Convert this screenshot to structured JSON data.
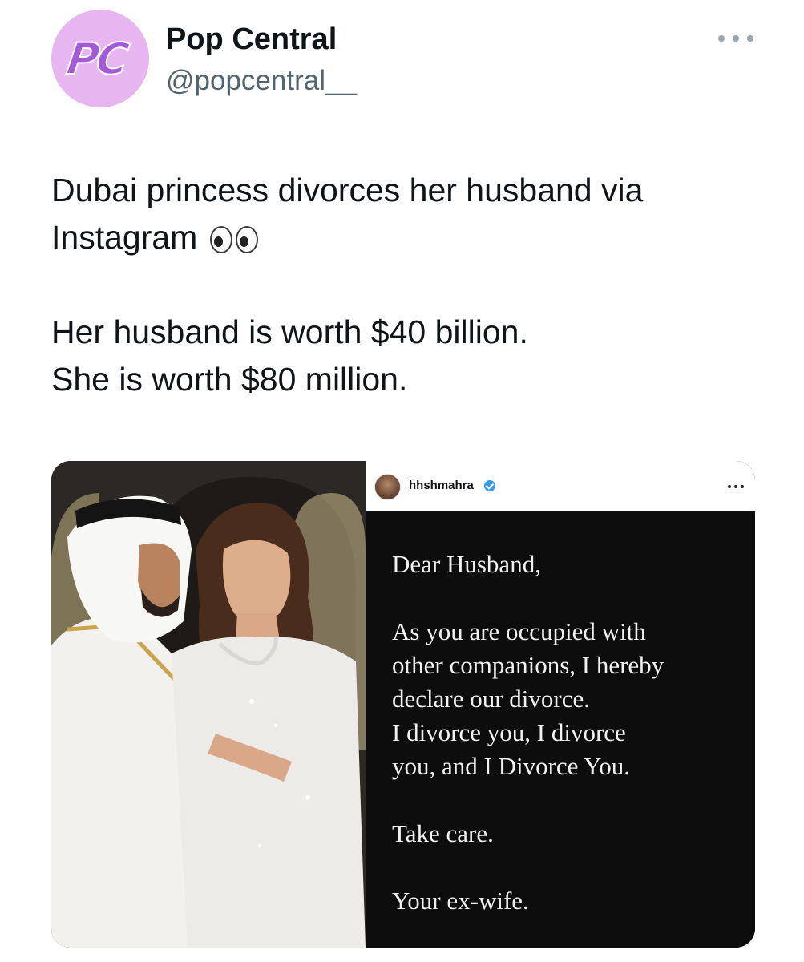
{
  "account": {
    "avatar_text": "PC",
    "display_name": "Pop Central",
    "handle": "@popcentral__"
  },
  "tweet": {
    "line1": "Dubai princess divorces her husband via",
    "line2": "Instagram",
    "line3": "Her husband is worth $40 billion.",
    "line4": "She is worth $80 million."
  },
  "media": {
    "instagram": {
      "username": "hhshmahra",
      "letter": {
        "salutation": "Dear Husband,",
        "body1": "As you are occupied with",
        "body2": "other companions, I hereby",
        "body3": "declare our divorce.",
        "body4": "I divorce you, I divorce",
        "body5": "you, and I Divorce You.",
        "closing": "Take care.",
        "signature": "Your ex-wife."
      }
    }
  },
  "icons": {
    "more": "more-horizontal-icon",
    "verified": "verified-badge-icon",
    "eyes": "eyes-emoji-icon"
  },
  "colors": {
    "avatar_bg": "#e7b6f0",
    "avatar_text": "#a45ad8",
    "handle": "#536471",
    "verified": "#3897f0"
  }
}
